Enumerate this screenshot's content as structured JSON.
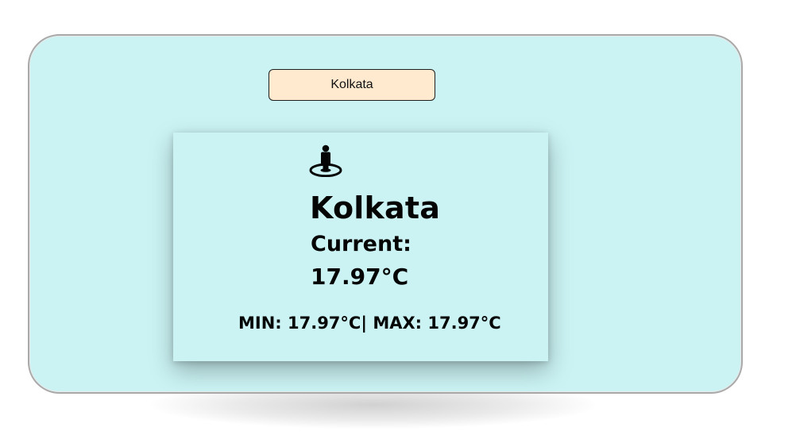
{
  "search": {
    "value": "Kolkata"
  },
  "weather": {
    "city": "Kolkata",
    "current_label": "Current:",
    "current_temp": "17.97°C",
    "min_max": "MIN: 17.97°C| MAX: 17.97°C"
  },
  "icons": {
    "location": "street-view-icon"
  },
  "colors": {
    "background": "#cbf3f4",
    "search_background": "#ffe9cf",
    "text": "#050505",
    "frame_border": "#a9a9a9"
  }
}
